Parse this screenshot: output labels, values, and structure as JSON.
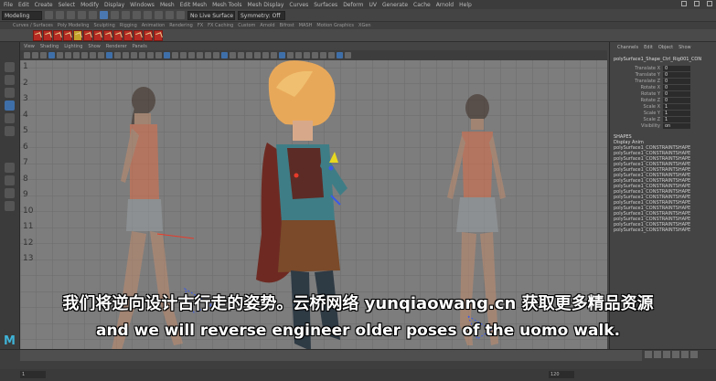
{
  "menubar": {
    "items": [
      "File",
      "Edit",
      "Create",
      "Select",
      "Modify",
      "Display",
      "Windows",
      "Mesh",
      "Edit Mesh",
      "Mesh Tools",
      "Mesh Display",
      "Curves",
      "Surfaces",
      "Deform",
      "UV",
      "Generate",
      "Cache",
      "Arnold",
      "Help"
    ]
  },
  "statusline": {
    "mode": "Modeling",
    "no_live": "No Live Surface",
    "symmetry": "Symmetry: Off"
  },
  "shelf_tabs": [
    "Curves / Surfaces",
    "Poly Modeling",
    "Sculpting",
    "Rigging",
    "Animation",
    "Rendering",
    "FX",
    "FX Caching",
    "Custom",
    "Arnold",
    "Bifrost",
    "MASH",
    "Motion Graphics",
    "XGen"
  ],
  "panel_menu": [
    "View",
    "Shading",
    "Lighting",
    "Show",
    "Renderer",
    "Panels"
  ],
  "viewport": {
    "row_labels": [
      "1",
      "2",
      "3",
      "4",
      "5",
      "6",
      "7",
      "8",
      "9",
      "10",
      "11",
      "12",
      "13"
    ]
  },
  "channel_box": {
    "tabs": [
      "Channels",
      "Edit",
      "Object",
      "Show"
    ],
    "object_name": "polySurface1_Shape_Ctrl_Rig001_CON",
    "attributes": [
      {
        "name": "Translate X",
        "value": "0"
      },
      {
        "name": "Translate Y",
        "value": "0"
      },
      {
        "name": "Translate Z",
        "value": "0"
      },
      {
        "name": "Rotate X",
        "value": "0"
      },
      {
        "name": "Rotate Y",
        "value": "0"
      },
      {
        "name": "Rotate Z",
        "value": "0"
      },
      {
        "name": "Scale X",
        "value": "1"
      },
      {
        "name": "Scale Y",
        "value": "1"
      },
      {
        "name": "Scale Z",
        "value": "1"
      },
      {
        "name": "Visibility",
        "value": "on"
      }
    ],
    "section_label": "SHAPES",
    "layers_header": "Display  Anim",
    "layers": [
      "polySurface1_CONSTRAINTSHAPE",
      "polySurface1_CONSTRAINTSHAPE",
      "polySurface1_CONSTRAINTSHAPE",
      "polySurface1_CONSTRAINTSHAPE",
      "polySurface1_CONSTRAINTSHAPE",
      "polySurface1_CONSTRAINTSHAPE",
      "polySurface1_CONSTRAINTSHAPE",
      "polySurface1_CONSTRAINTSHAPE",
      "polySurface1_CONSTRAINTSHAPE",
      "polySurface1_CONSTRAINTSHAPE",
      "polySurface1_CONSTRAINTSHAPE",
      "polySurface1_CONSTRAINTSHAPE",
      "polySurface1_CONSTRAINTSHAPE",
      "polySurface1_CONSTRAINTSHAPE",
      "polySurface1_CONSTRAINTSHAPE",
      "polySurface1_CONSTRAINTSHAPE"
    ]
  },
  "timeline": {
    "start": "1",
    "end": "120"
  },
  "subtitles": {
    "zh": "我们将逆向设计古行走的姿势。云桥网络 yunqiaowang.cn  获取更多精品资源",
    "en": "and we will reverse engineer older poses of the uomo walk."
  },
  "logo": "M",
  "colors": {
    "accent": "#4b77b0",
    "shelf_red": "#b52b23",
    "viewport_bg": "#7d7d7d"
  }
}
